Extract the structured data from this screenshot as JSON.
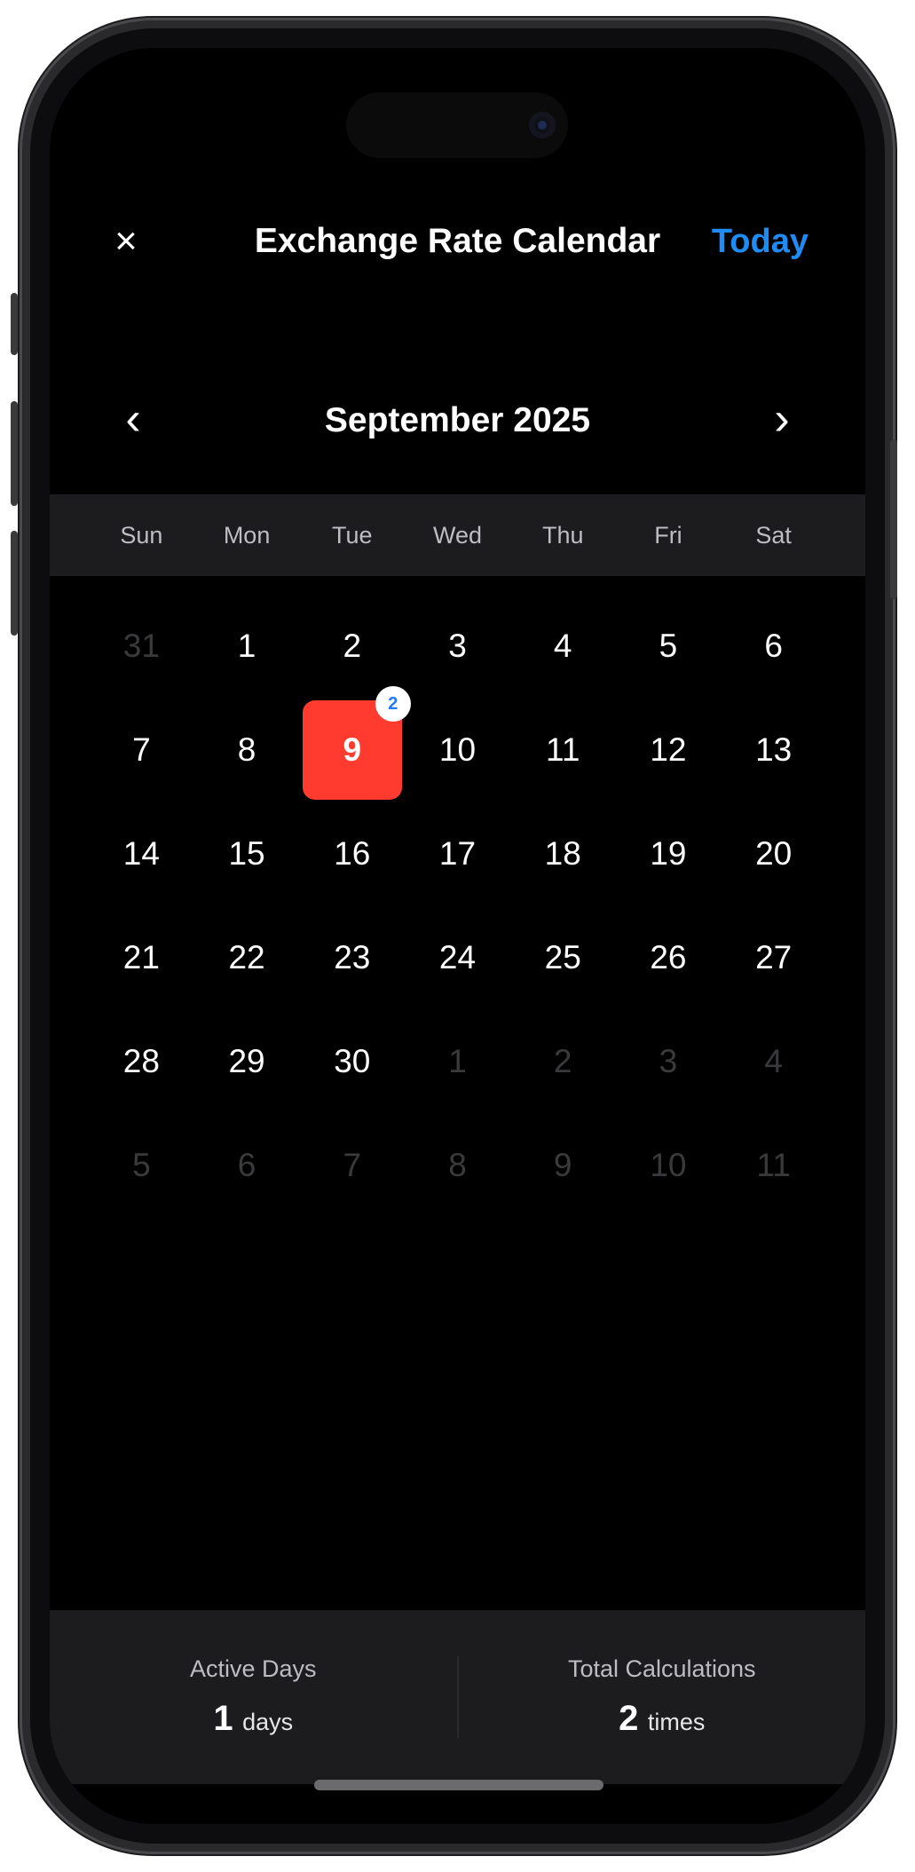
{
  "header": {
    "close_icon": "×",
    "title": "Exchange Rate Calendar",
    "today_label": "Today"
  },
  "month_nav": {
    "prev_icon": "‹",
    "next_icon": "›",
    "month_label": "September 2025"
  },
  "weekdays": [
    "Sun",
    "Mon",
    "Tue",
    "Wed",
    "Thu",
    "Fri",
    "Sat"
  ],
  "calendar": {
    "selected_day": "9",
    "selected_badge": "2",
    "days": [
      {
        "label": "31",
        "muted": true
      },
      {
        "label": "1",
        "muted": false
      },
      {
        "label": "2",
        "muted": false
      },
      {
        "label": "3",
        "muted": false
      },
      {
        "label": "4",
        "muted": false
      },
      {
        "label": "5",
        "muted": false
      },
      {
        "label": "6",
        "muted": false
      },
      {
        "label": "7",
        "muted": false
      },
      {
        "label": "8",
        "muted": false
      },
      {
        "label": "9",
        "muted": false,
        "selected": true,
        "badge": "2"
      },
      {
        "label": "10",
        "muted": false
      },
      {
        "label": "11",
        "muted": false
      },
      {
        "label": "12",
        "muted": false
      },
      {
        "label": "13",
        "muted": false
      },
      {
        "label": "14",
        "muted": false
      },
      {
        "label": "15",
        "muted": false
      },
      {
        "label": "16",
        "muted": false
      },
      {
        "label": "17",
        "muted": false
      },
      {
        "label": "18",
        "muted": false
      },
      {
        "label": "19",
        "muted": false
      },
      {
        "label": "20",
        "muted": false
      },
      {
        "label": "21",
        "muted": false
      },
      {
        "label": "22",
        "muted": false
      },
      {
        "label": "23",
        "muted": false
      },
      {
        "label": "24",
        "muted": false
      },
      {
        "label": "25",
        "muted": false
      },
      {
        "label": "26",
        "muted": false
      },
      {
        "label": "27",
        "muted": false
      },
      {
        "label": "28",
        "muted": false
      },
      {
        "label": "29",
        "muted": false
      },
      {
        "label": "30",
        "muted": false
      },
      {
        "label": "1",
        "muted": true
      },
      {
        "label": "2",
        "muted": true
      },
      {
        "label": "3",
        "muted": true
      },
      {
        "label": "4",
        "muted": true
      },
      {
        "label": "5",
        "muted": true
      },
      {
        "label": "6",
        "muted": true
      },
      {
        "label": "7",
        "muted": true
      },
      {
        "label": "8",
        "muted": true
      },
      {
        "label": "9",
        "muted": true
      },
      {
        "label": "10",
        "muted": true
      },
      {
        "label": "11",
        "muted": true
      }
    ]
  },
  "stats": {
    "active_days_label": "Active Days",
    "active_days_value": "1",
    "active_days_unit": "days",
    "total_calc_label": "Total Calculations",
    "total_calc_value": "2",
    "total_calc_unit": "times"
  },
  "colors": {
    "accent": "#1f8cf5",
    "selected": "#ff3b30",
    "background": "#000000",
    "panel": "#1c1c1e"
  }
}
